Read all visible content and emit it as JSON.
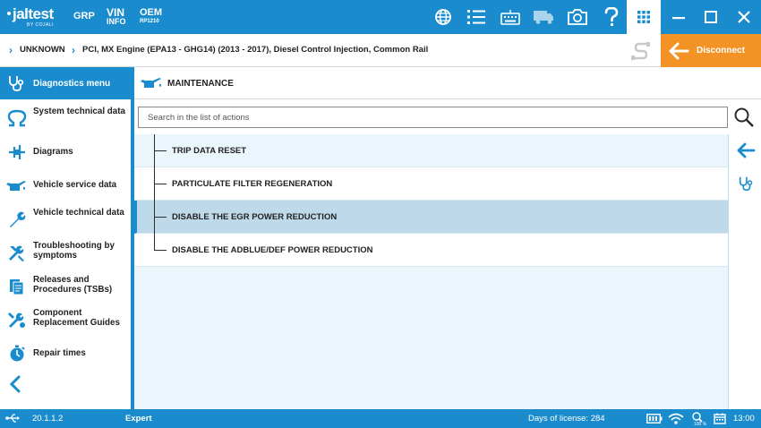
{
  "topbar": {
    "logo_text": "jaltest",
    "logo_sub": "BY COJALI",
    "grp_label": "GRP",
    "vin_label": "VIN",
    "vin_sub": "INFO",
    "oem_label": "OEM",
    "oem_sub": "RP1210",
    "icons": [
      "globe-icon",
      "list-icon",
      "keyboard-icon",
      "truck-icon",
      "camera-icon",
      "help-icon",
      "apps-grid-icon",
      "minimize-icon",
      "maximize-icon",
      "close-icon"
    ],
    "color": "#1a8ccd"
  },
  "breadcrumb": {
    "item1": "UNKNOWN",
    "item2": "PCI, MX Engine (EPA13 - GHG14) (2013 - 2017), Diesel Control Injection, Common Rail"
  },
  "disconnect": {
    "label": "Disconnect",
    "color": "#f39325"
  },
  "sidebar": {
    "active_label": "Diagnostics menu",
    "items": [
      {
        "label": "System technical data",
        "icon": "ohm-icon"
      },
      {
        "label": "Diagrams",
        "icon": "diagram-icon"
      },
      {
        "label": "Vehicle service data",
        "icon": "oil-can-icon"
      },
      {
        "label": "Vehicle technical data",
        "icon": "wrench-icon"
      },
      {
        "label": "Troubleshooting by symptoms",
        "icon": "tools-icon"
      },
      {
        "label": "Releases and Procedures (TSBs)",
        "icon": "documents-icon"
      },
      {
        "label": "Component Replacement Guides",
        "icon": "replacement-icon"
      },
      {
        "label": "Repair times",
        "icon": "stopwatch-icon"
      }
    ]
  },
  "main": {
    "title": "MAINTENANCE",
    "search_placeholder": "Search in the list of actions",
    "actions": [
      {
        "label": "TRIP DATA RESET"
      },
      {
        "label": "PARTICULATE FILTER REGENERATION"
      },
      {
        "label": "DISABLE THE EGR POWER REDUCTION",
        "selected": true
      },
      {
        "label": "DISABLE THE ADBLUE/DEF POWER REDUCTION"
      }
    ]
  },
  "statusbar": {
    "version": "20.1.1.2",
    "mode": "Expert",
    "license": "Days of license: 284",
    "zoom": "100 %",
    "time": "13:00"
  }
}
